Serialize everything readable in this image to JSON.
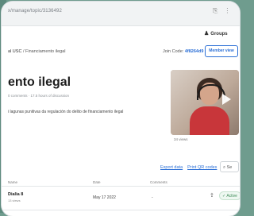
{
  "browser": {
    "url": "x/manage/topic/3136492",
    "icons": [
      "⎘",
      "⋮"
    ]
  },
  "header": {
    "groups_label": "Groups",
    "groups_icon": "people-icon"
  },
  "breadcrumb": {
    "group": "al USC",
    "separator": "/",
    "topic": "Financiamento ilegal"
  },
  "join": {
    "label": "Join Code:",
    "code": "4f8264d9"
  },
  "member_view_button": "Member view",
  "topic": {
    "title": "ento ilegal",
    "meta": "0 comments · 17.5 hours of discussion",
    "description": "i lagunas punitivas da regulación do delito de financiamento ilegal"
  },
  "video": {
    "views": "34 views",
    "play_icon": "play-icon"
  },
  "actions": {
    "export": "Export data",
    "qr": "Print QR codes",
    "search": "Se"
  },
  "table": {
    "headers": {
      "name": "Name",
      "date": "Date",
      "comments": "Comments"
    },
    "rows": [
      {
        "name": "Dialia 8",
        "sub": "13 views",
        "date": "May 17 2022",
        "comments": "-",
        "status": "Active"
      }
    ]
  }
}
